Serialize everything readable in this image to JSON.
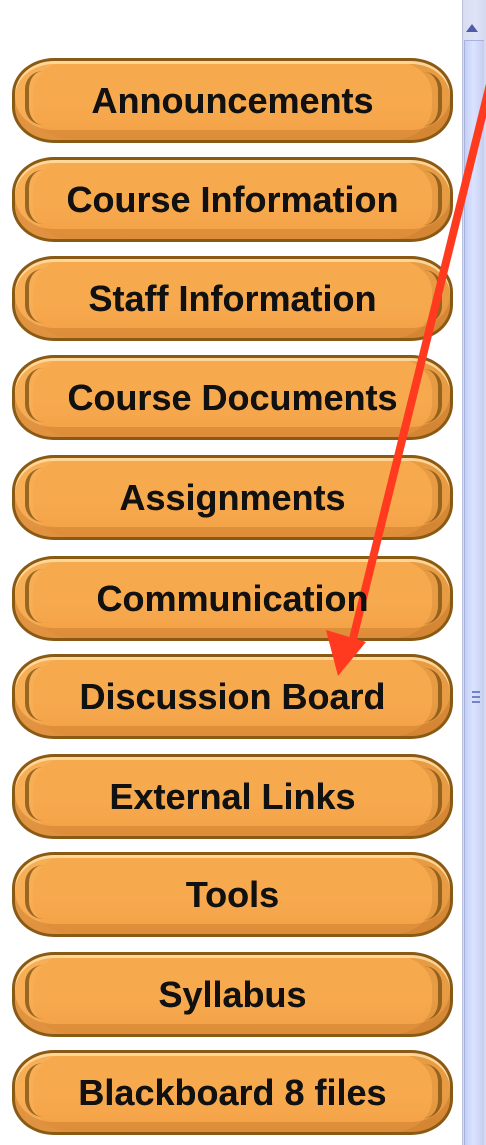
{
  "navigation": {
    "items": [
      {
        "label": "Announcements"
      },
      {
        "label": "Course Information"
      },
      {
        "label": "Staff Information"
      },
      {
        "label": "Course Documents"
      },
      {
        "label": "Assignments"
      },
      {
        "label": "Communication"
      },
      {
        "label": "Discussion Board"
      },
      {
        "label": "External Links"
      },
      {
        "label": "Tools"
      },
      {
        "label": "Syllabus"
      },
      {
        "label": "Blackboard 8 files"
      }
    ]
  },
  "theme": {
    "button_fill": "#f7a94e",
    "button_outline": "#8a5a14",
    "label_color": "#111111",
    "scrollbar_color": "#dbe3ff",
    "annotation_arrow_color": "#ff3a1f"
  },
  "annotation": {
    "icon": "red-arrow-icon",
    "target": "Discussion Board"
  }
}
